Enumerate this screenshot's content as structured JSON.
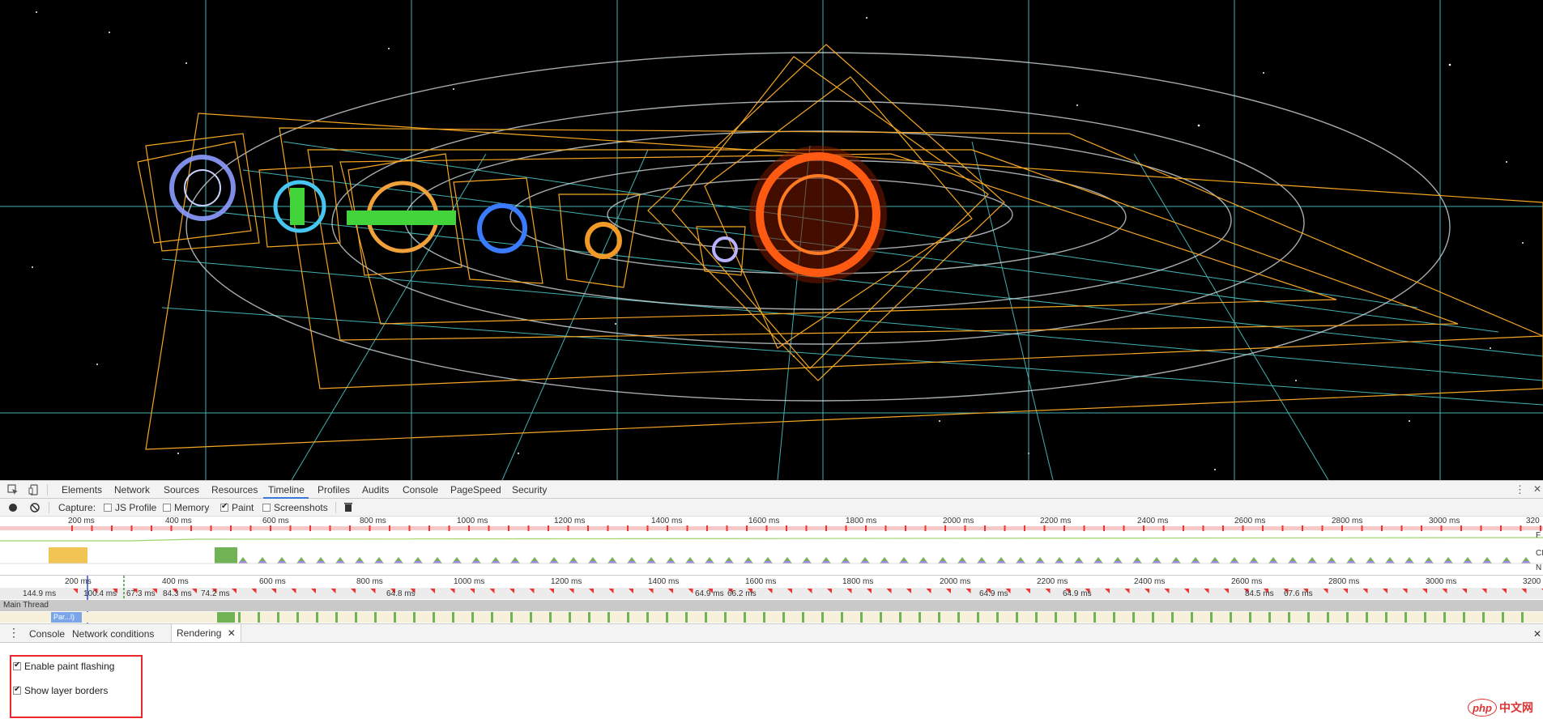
{
  "colors": {
    "accent": "#3879d9",
    "fps_green": "#9fd46c",
    "script_yellow": "#f1c453",
    "paint_green": "#6fb354",
    "render_purple": "#a389d6",
    "frame_marker_red": "#e33",
    "highlight_box": "#e8262c",
    "layer_border_orange": "#f5a623",
    "layer_grid_cyan": "#4fd0d0"
  },
  "toolbar": {
    "inspect_icon": "inspect-element-icon",
    "device_icon": "device-mode-icon",
    "tabs": [
      "Elements",
      "Network",
      "Sources",
      "Resources",
      "Timeline",
      "Profiles",
      "Audits",
      "Console",
      "PageSpeed",
      "Security"
    ],
    "active_tab": "Timeline",
    "more_icon": "⋮",
    "close_icon": "✕"
  },
  "capture": {
    "label": "Capture:",
    "js_profile": {
      "label": "JS Profile",
      "checked": false
    },
    "memory": {
      "label": "Memory",
      "checked": false
    },
    "paint": {
      "label": "Paint",
      "checked": true
    },
    "screenshots": {
      "label": "Screenshots",
      "checked": false
    }
  },
  "overview_ruler": [
    "200 ms",
    "400 ms",
    "600 ms",
    "800 ms",
    "1000 ms",
    "1200 ms",
    "1400 ms",
    "1600 ms",
    "1800 ms",
    "2000 ms",
    "2200 ms",
    "2400 ms",
    "2600 ms",
    "2800 ms",
    "3000 ms",
    "320"
  ],
  "overview_side_labels": [
    "F",
    "CI",
    "N"
  ],
  "detail_ruler": [
    "200 ms",
    "400 ms",
    "600 ms",
    "800 ms",
    "1000 ms",
    "1200 ms",
    "1400 ms",
    "1600 ms",
    "1800 ms",
    "2000 ms",
    "2200 ms",
    "2400 ms",
    "2600 ms",
    "2800 ms",
    "3000 ms",
    "3200"
  ],
  "frame_durations": [
    "144.9 ms",
    "100.4 ms",
    "67.3 ms",
    "84.3 ms",
    "74.2 ms",
    "64.8 ms",
    "64.9 ms",
    "66.2 ms",
    "64.9 ms",
    "64.9 ms",
    "84.5 ms",
    "67.6 ms"
  ],
  "main_thread": {
    "label": "Main Thread",
    "task": "Par...l)"
  },
  "drawer": {
    "tabs": [
      "Console",
      "Network conditions",
      "Rendering"
    ],
    "active_tab": "Rendering",
    "close_tab_icon": "✕",
    "close_icon": "✕",
    "options": [
      {
        "label": "Enable paint flashing",
        "checked": true
      },
      {
        "label": "Show layer borders",
        "checked": true
      }
    ]
  },
  "watermark": {
    "logo": "php",
    "text": "中文网"
  }
}
